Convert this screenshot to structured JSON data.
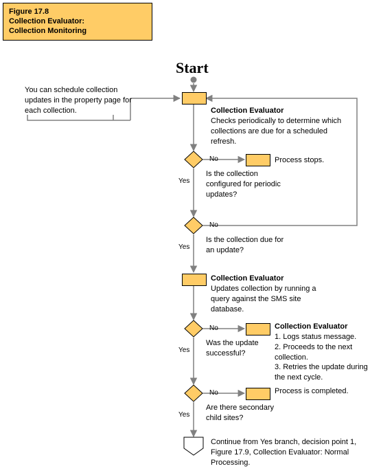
{
  "title": {
    "line1": "Figure 17.8",
    "line2": "Collection Evaluator:",
    "line3": "Collection Monitoring"
  },
  "start": "Start",
  "note1": "You can schedule collection updates in the property page for each collection.",
  "step1": {
    "heading": "Collection Evaluator",
    "body": "Checks periodically to determine which collections are due for a scheduled refresh."
  },
  "d1": {
    "q": "Is the collection configured for periodic updates?",
    "yes": "Yes",
    "no": "No",
    "noResult": "Process stops."
  },
  "d2": {
    "q": "Is the collection due for an update?",
    "yes": "Yes",
    "no": "No"
  },
  "step2": {
    "heading": "Collection Evaluator",
    "body": "Updates collection by running a query against the SMS site database."
  },
  "d3": {
    "q": "Was the update successful?",
    "yes": "Yes",
    "no": "No",
    "noHeading": "Collection Evaluator",
    "no1": "1. Logs status message.",
    "no2": "2. Proceeds to the next collection.",
    "no3": "3. Retries the update during the next cycle."
  },
  "d4": {
    "q": "Are there secondary child sites?",
    "yes": "Yes",
    "no": "No",
    "noResult": "Process is completed."
  },
  "continue": "Continue from Yes branch, decision point 1, Figure 17.9, Collection Evaluator: Normal Processing."
}
